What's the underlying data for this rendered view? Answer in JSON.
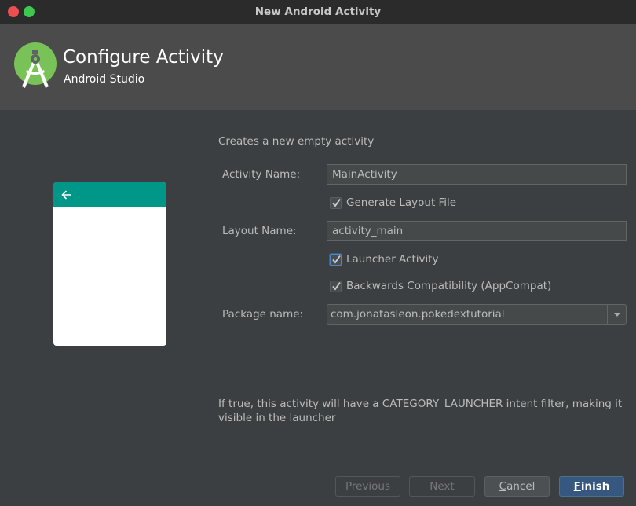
{
  "window": {
    "title": "New Android Activity"
  },
  "header": {
    "title": "Configure Activity",
    "subtitle": "Android Studio",
    "logo_icon": "android-studio-icon"
  },
  "preview": {
    "toolbar_icon": "back-arrow-icon",
    "toolbar_color": "#009688"
  },
  "form": {
    "description": "Creates a new empty activity",
    "activity_name": {
      "label": "Activity Name:",
      "value": "MainActivity"
    },
    "generate_layout": {
      "label": "Generate Layout File",
      "checked": true
    },
    "layout_name": {
      "label": "Layout Name:",
      "value": "activity_main"
    },
    "launcher_activity": {
      "label": "Launcher Activity",
      "checked": true,
      "focused": true
    },
    "backwards_compat": {
      "label": "Backwards Compatibility (AppCompat)",
      "checked": true
    },
    "package_name": {
      "label": "Package name:",
      "value": "com.jonatasleon.pokedextutorial"
    }
  },
  "help_text": "If true, this activity will have a CATEGORY_LAUNCHER intent filter, making it visible in the launcher",
  "buttons": {
    "previous": {
      "label": "Previous",
      "enabled": false
    },
    "next": {
      "label": "Next",
      "enabled": false
    },
    "cancel": {
      "label": "Cancel",
      "mnemonic": "C",
      "rest": "ancel",
      "enabled": true
    },
    "finish": {
      "label": "Finish",
      "mnemonic": "F",
      "rest": "inish",
      "enabled": true,
      "default": true
    }
  },
  "colors": {
    "accent": "#365880",
    "background": "#3c3f41",
    "header": "#4b4b4b",
    "titlebar": "#2b2b2b",
    "logo_green": "#78c257"
  }
}
